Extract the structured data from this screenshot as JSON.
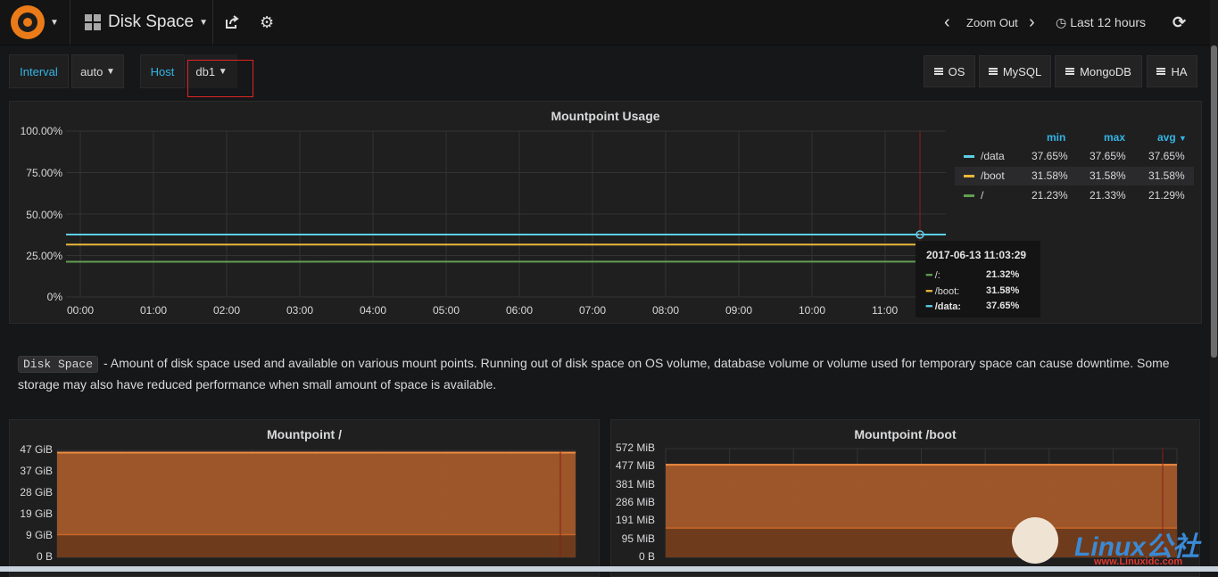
{
  "topbar": {
    "dashboard_title": "Disk Space",
    "zoom_out": "Zoom Out",
    "time_range": "Last 12 hours"
  },
  "variables": {
    "interval_label": "Interval",
    "interval_value": "auto",
    "host_label": "Host",
    "host_value": "db1"
  },
  "links": [
    "OS",
    "MySQL",
    "MongoDB",
    "HA"
  ],
  "usage_panel": {
    "title": "Mountpoint Usage",
    "legend_headers": {
      "min": "min",
      "max": "max",
      "avg": "avg"
    },
    "legend": [
      {
        "name": "/data",
        "color": "#5ccfe6",
        "min": "37.65%",
        "max": "37.65%",
        "avg": "37.65%"
      },
      {
        "name": "/boot",
        "color": "#eab839",
        "min": "31.58%",
        "max": "31.58%",
        "avg": "31.58%"
      },
      {
        "name": "/",
        "color": "#629e51",
        "min": "21.23%",
        "max": "21.33%",
        "avg": "21.29%"
      }
    ],
    "tooltip": {
      "time": "2017-06-13 11:03:29",
      "rows": [
        {
          "name": "/:",
          "value": "21.32%",
          "color": "#629e51"
        },
        {
          "name": "/boot:",
          "value": "31.58%",
          "color": "#eab839"
        },
        {
          "name": "/data:",
          "value": "37.65%",
          "color": "#5ccfe6"
        }
      ]
    }
  },
  "chart_data": [
    {
      "type": "line",
      "title": "Mountpoint Usage",
      "x": [
        "00:00",
        "01:00",
        "02:00",
        "03:00",
        "04:00",
        "05:00",
        "06:00",
        "07:00",
        "08:00",
        "09:00",
        "10:00",
        "11:00"
      ],
      "yticks": [
        "100.00%",
        "75.00%",
        "50.00%",
        "25.00%",
        "0%"
      ],
      "ylim": [
        0,
        100
      ],
      "series": [
        {
          "name": "/data",
          "values": [
            37.65,
            37.65,
            37.65,
            37.65,
            37.65,
            37.65,
            37.65,
            37.65,
            37.65,
            37.65,
            37.65,
            37.65,
            37.65
          ]
        },
        {
          "name": "/boot",
          "values": [
            31.58,
            31.58,
            31.58,
            31.58,
            31.58,
            31.58,
            31.58,
            31.58,
            31.58,
            31.58,
            31.58,
            31.58,
            31.58
          ]
        },
        {
          "name": "/",
          "values": [
            21.23,
            21.25,
            21.26,
            21.27,
            21.28,
            21.29,
            21.3,
            21.3,
            21.31,
            21.31,
            21.32,
            21.33,
            21.32
          ]
        }
      ]
    },
    {
      "type": "area",
      "title": "Mountpoint /",
      "yticks": [
        "47 GiB",
        "37 GiB",
        "28 GiB",
        "19 GiB",
        "9 GiB",
        "0 B"
      ],
      "ylim": [
        0,
        47
      ],
      "series": [
        {
          "values": [
            46,
            46
          ]
        },
        {
          "values": [
            10,
            10
          ]
        }
      ]
    },
    {
      "type": "area",
      "title": "Mountpoint /boot",
      "yticks": [
        "572 MiB",
        "477 MiB",
        "381 MiB",
        "286 MiB",
        "191 MiB",
        "95 MiB",
        "0 B"
      ],
      "ylim": [
        0,
        572
      ],
      "series": [
        {
          "values": [
            487,
            487
          ]
        },
        {
          "values": [
            154,
            154
          ]
        }
      ]
    }
  ],
  "text_panel": {
    "code": "Disk Space",
    "text": "- Amount of disk space used and available on various mount points. Running out of disk space on OS volume, database volume or volume used for temporary space can cause downtime. Some storage may also have reduced performance when small amount of space is available."
  },
  "watermark": {
    "brand": "Linux公社",
    "url": "www.Linuxidc.com"
  }
}
